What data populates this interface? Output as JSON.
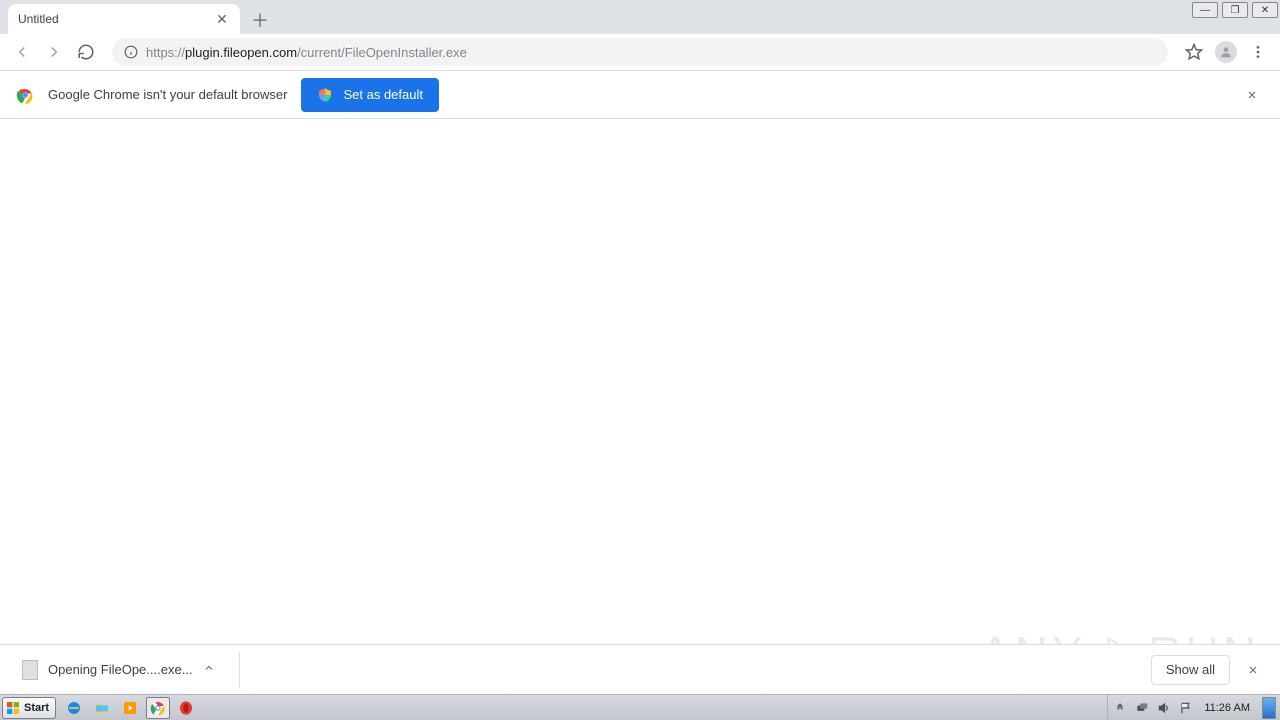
{
  "tab": {
    "title": "Untitled"
  },
  "url": {
    "scheme": "https://",
    "host": "plugin.fileopen.com",
    "path": "/current/FileOpenInstaller.exe"
  },
  "infobar": {
    "message": "Google Chrome isn't your default browser",
    "button": "Set as default"
  },
  "download": {
    "filename": "Opening FileOpe....exe...",
    "show_all": "Show all"
  },
  "taskbar": {
    "start": "Start",
    "clock": "11:26 AM"
  },
  "watermark": {
    "left": "ANY",
    "right": "RUN"
  }
}
